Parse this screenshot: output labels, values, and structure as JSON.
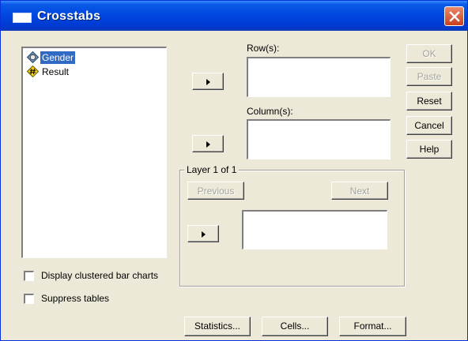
{
  "window": {
    "title": "Crosstabs"
  },
  "variables": [
    {
      "label": "Gender",
      "icon": "nominal-variable-icon",
      "selected": true
    },
    {
      "label": "Result",
      "icon": "scale-variable-icon",
      "selected": false
    }
  ],
  "targets": {
    "rows_label": "Row(s):",
    "columns_label": "Column(s):",
    "layer_label": "Layer 1 of 1"
  },
  "layer_buttons": {
    "previous": "Previous",
    "next": "Next"
  },
  "buttons": {
    "ok": "OK",
    "paste": "Paste",
    "reset": "Reset",
    "cancel": "Cancel",
    "help": "Help"
  },
  "options": {
    "clustered_bar": {
      "label": "Display clustered bar charts",
      "checked": false
    },
    "suppress_tables": {
      "label": "Suppress tables",
      "checked": false
    }
  },
  "bottom_buttons": {
    "statistics": "Statistics...",
    "cells": "Cells...",
    "format": "Format..."
  },
  "colors": {
    "title_bar": "#0046e0",
    "dialog_face": "#ece9d8",
    "selection": "#316ac5",
    "close_button": "#c9401e"
  }
}
